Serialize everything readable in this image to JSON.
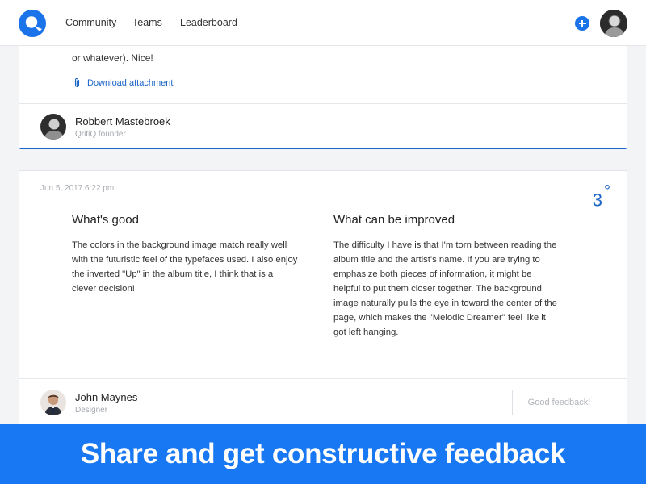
{
  "nav": {
    "logo_icon": "qritiq-logo",
    "links": [
      {
        "label": "Community"
      },
      {
        "label": "Teams"
      },
      {
        "label": "Leaderboard"
      }
    ],
    "add_icon": "plus-circle-icon",
    "accent": "#1a73e8"
  },
  "highlighted_review": {
    "body_tail": "or whatever). Nice!",
    "attachment_label": "Download attachment",
    "attachment_icon": "paperclip-icon",
    "author": {
      "name": "Robbert Mastebroek",
      "role": "QritiQ founder"
    },
    "border_color": "#1a63c7"
  },
  "review": {
    "date": "Jun 5, 2017 6:22 pm",
    "rating": "3",
    "rating_suffix": "°",
    "good": {
      "heading": "What's good",
      "text": "The colors in the background image match really well with the futuristic feel of the typefaces used. I also enjoy the inverted \"Up\" in the album title, I think that is a clever decision!"
    },
    "improve": {
      "heading": "What can be improved",
      "text": "The difficulty I have is that I'm torn between reading the album title and the artist's name. If you are trying to emphasize both pieces of information, it might be helpful to put them closer together. The background image naturally pulls the eye in toward the center of the page, which makes the \"Melodic Dreamer\" feel like it got left hanging."
    },
    "author": {
      "name": "John Maynes",
      "role": "Designer"
    },
    "feedback_button": "Good feedback!"
  },
  "banner": {
    "text": "Share and get constructive feedback",
    "color": "#1877f2"
  }
}
